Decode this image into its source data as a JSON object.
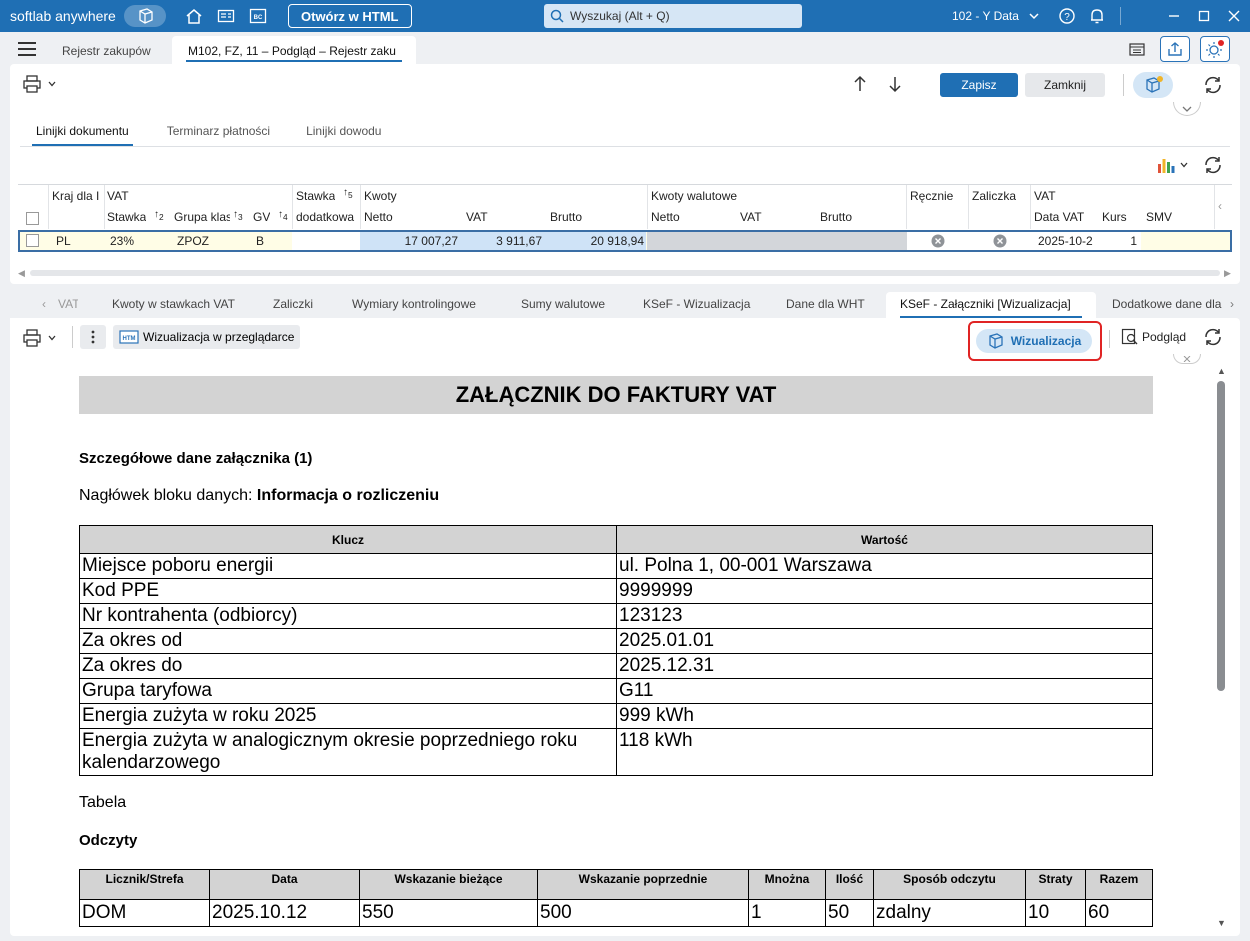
{
  "titlebar": {
    "brand": "softlab anywhere",
    "html_button": "Otwórz w HTML",
    "search_placeholder": "Wyszukaj (Alt + Q)",
    "company": "102 - Y Data"
  },
  "tabs": [
    {
      "label": "Rejestr zakupów"
    },
    {
      "label": "M102, FZ, 11 – Podgląd – Rejestr zaku"
    }
  ],
  "toolbar": {
    "save_label": "Zapisz",
    "close_label": "Zamknij"
  },
  "subtabs": [
    "Linijki dokumentu",
    "Terminarz płatności",
    "Linijki dowodu"
  ],
  "grid": {
    "group_headers": [
      "Kraj dla I",
      "VAT",
      "Stawka",
      "Kwoty",
      "Kwoty walutowe",
      "Ręcznie",
      "Zaliczka",
      "VAT"
    ],
    "sub_headers": [
      "Stawka",
      "Grupa klas",
      "GV",
      "dodatkowa",
      "Netto",
      "VAT",
      "Brutto",
      "Netto",
      "VAT",
      "Brutto",
      "Data VAT",
      "Kurs",
      "SMV"
    ],
    "sort_marks": [
      "2",
      "3",
      "4",
      "5"
    ],
    "row": {
      "kraj": "PL",
      "stawka": "23%",
      "grupa": "ZPOZ",
      "gv": "B",
      "netto": "17 007,27",
      "vat": "3 911,67",
      "brutto": "20 918,94",
      "data_vat": "2025-10-2",
      "kurs": "1"
    }
  },
  "bottom_tabs": [
    "VAT",
    "Kwoty w stawkach VAT",
    "Zaliczki",
    "Wymiary kontrolingowe",
    "Sumy walutowe",
    "KSeF - Wizualizacja",
    "Dane dla WHT",
    "KSeF - Załączniki [Wizualizacja]",
    "Dodatkowe dane dla"
  ],
  "panel2": {
    "browser_button": "Wizualizacja w przeglądarce",
    "wizualizacja_button": "Wizualizacja",
    "podglad_button": "Podgląd"
  },
  "document": {
    "title": "ZAŁĄCZNIK DO FAKTURY VAT",
    "section_heading": "Szczegółowe dane załącznika (1)",
    "block_label": "Nagłówek bloku danych: ",
    "block_value": "Informacja o rozliczeniu",
    "kv_headers": [
      "Klucz",
      "Wartość"
    ],
    "kv_rows": [
      {
        "k": "Miejsce poboru energii",
        "v": "ul. Polna 1, 00-001 Warszawa"
      },
      {
        "k": "Kod PPE",
        "v": "9999999"
      },
      {
        "k": "Nr kontrahenta (odbiorcy)",
        "v": "123123"
      },
      {
        "k": "Za okres od",
        "v": "2025.01.01"
      },
      {
        "k": "Za okres do",
        "v": "2025.12.31"
      },
      {
        "k": "Grupa taryfowa",
        "v": "G11"
      },
      {
        "k": "Energia zużyta w roku 2025",
        "v": "999 kWh"
      },
      {
        "k": "Energia zużyta w analogicznym okresie poprzedniego roku kalendarzowego",
        "v": "118 kWh"
      }
    ],
    "tabela_label": "Tabela",
    "readings_heading": "Odczyty",
    "readings_headers": [
      "Licznik/Strefa",
      "Data",
      "Wskazanie bieżące",
      "Wskazanie poprzednie",
      "Mnożna",
      "Ilość",
      "Sposób odczytu",
      "Straty",
      "Razem"
    ],
    "readings_rows": [
      [
        "DOM",
        "2025.10.12",
        "550",
        "500",
        "1",
        "50",
        "zdalny",
        "10",
        "60"
      ]
    ]
  },
  "colors": {
    "accent": "#1f6fb4",
    "highlight_border": "#e02424"
  }
}
